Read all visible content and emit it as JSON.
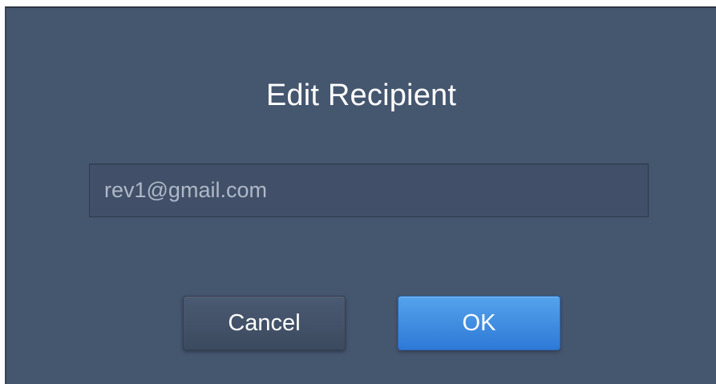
{
  "dialog": {
    "title": "Edit Recipient",
    "recipient_input": {
      "value": "rev1@gmail.com"
    },
    "buttons": {
      "cancel_label": "Cancel",
      "ok_label": "OK"
    }
  },
  "colors": {
    "dialog_background": "#45566f",
    "input_background": "#415068",
    "cancel_button": "#42516a",
    "ok_button": "#3d8ee3",
    "title_text": "#ffffff",
    "input_text": "#aeb8c8"
  }
}
